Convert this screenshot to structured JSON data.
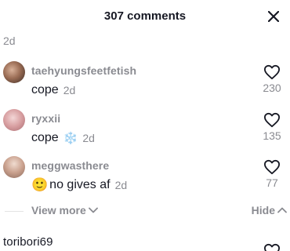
{
  "header": {
    "title": "307 comments"
  },
  "top_time": "2d",
  "comments": [
    {
      "username": "taehyungsfeetfetish",
      "text": "cope",
      "time": "2d",
      "likes": "230"
    },
    {
      "username": "ryxxii",
      "text": "cope",
      "emoji": "❄️",
      "time": "2d",
      "likes": "135"
    },
    {
      "username": "meggwasthere",
      "emoji": "🙂",
      "text": "no gives af",
      "time": "2d",
      "likes": "77"
    }
  ],
  "view_more": {
    "label": "View more"
  },
  "hide": {
    "label": "Hide"
  },
  "next_comment": {
    "username": "toribori69"
  }
}
